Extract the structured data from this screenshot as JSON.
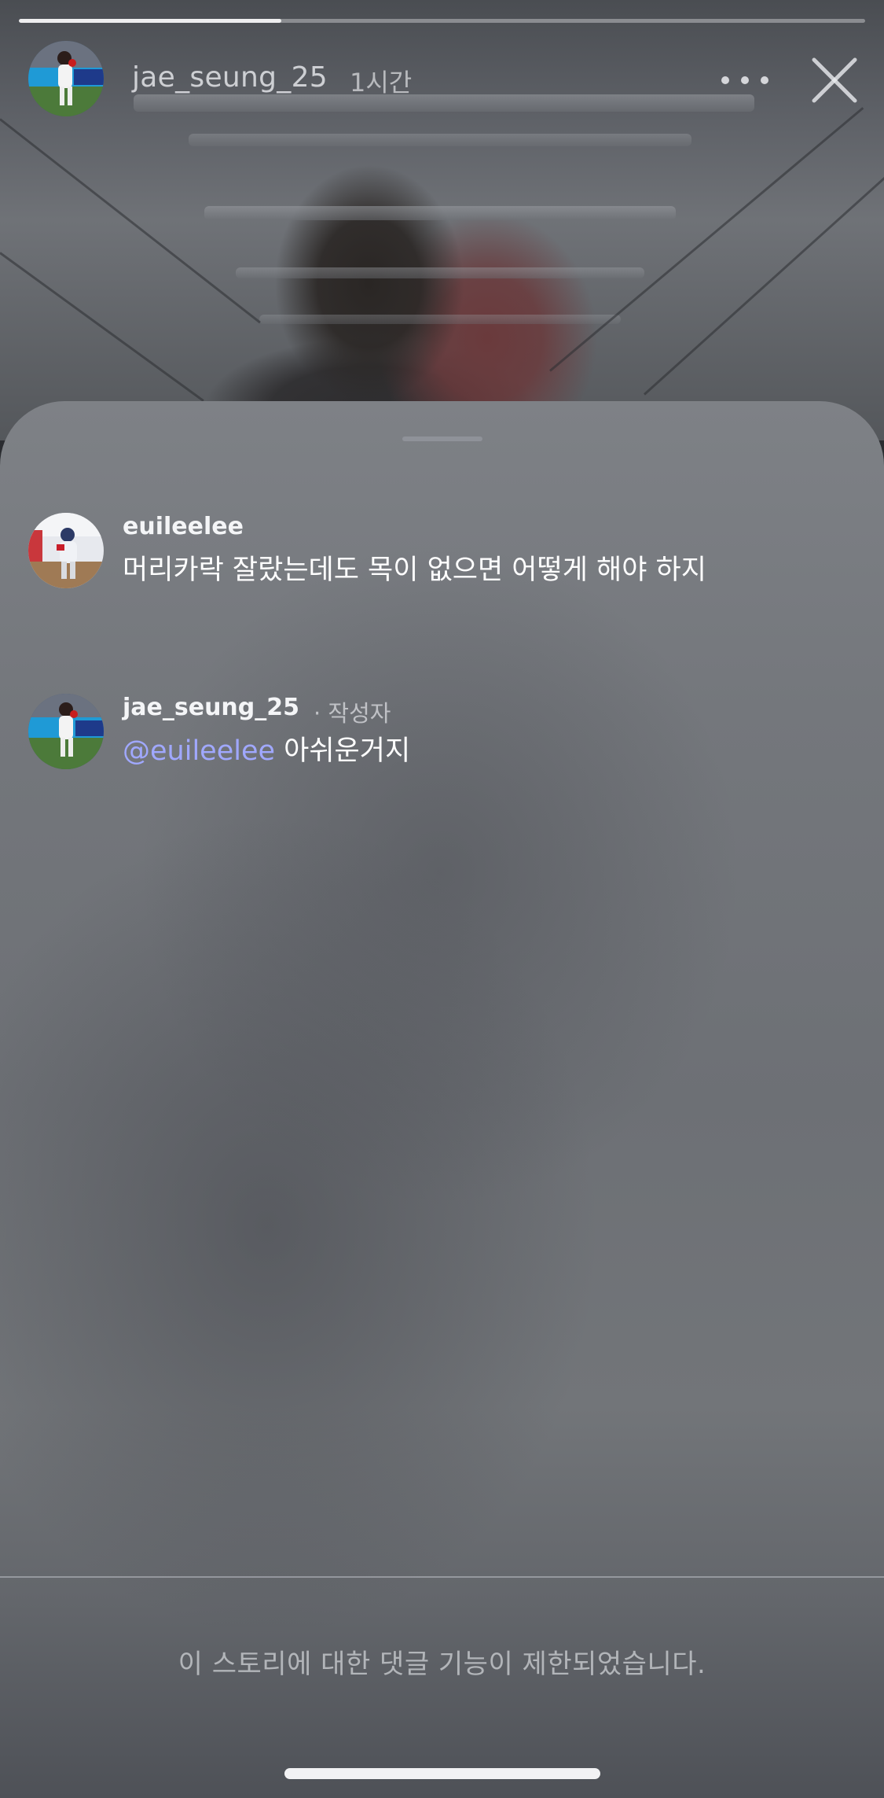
{
  "story": {
    "progress": 0.31,
    "username": "jae_seung_25",
    "time_ago": "1시간",
    "more_icon": "more-horizontal-icon",
    "close_icon": "close-x-icon"
  },
  "comments": [
    {
      "username": "euileelee",
      "text": "머리카락 잘랐는데도 목이 없으면 어떻게 해야 하지"
    },
    {
      "username": "jae_seung_25",
      "author_tag": "· 작성자",
      "mention": "@euileelee",
      "text": " 아쉬운거지"
    }
  ],
  "footer": {
    "restricted_notice": "이 스토리에 대한 댓글 기능이 제한되었습니다."
  },
  "colors": {
    "mention": "#a0a8ff",
    "text_primary": "#ffffff"
  }
}
